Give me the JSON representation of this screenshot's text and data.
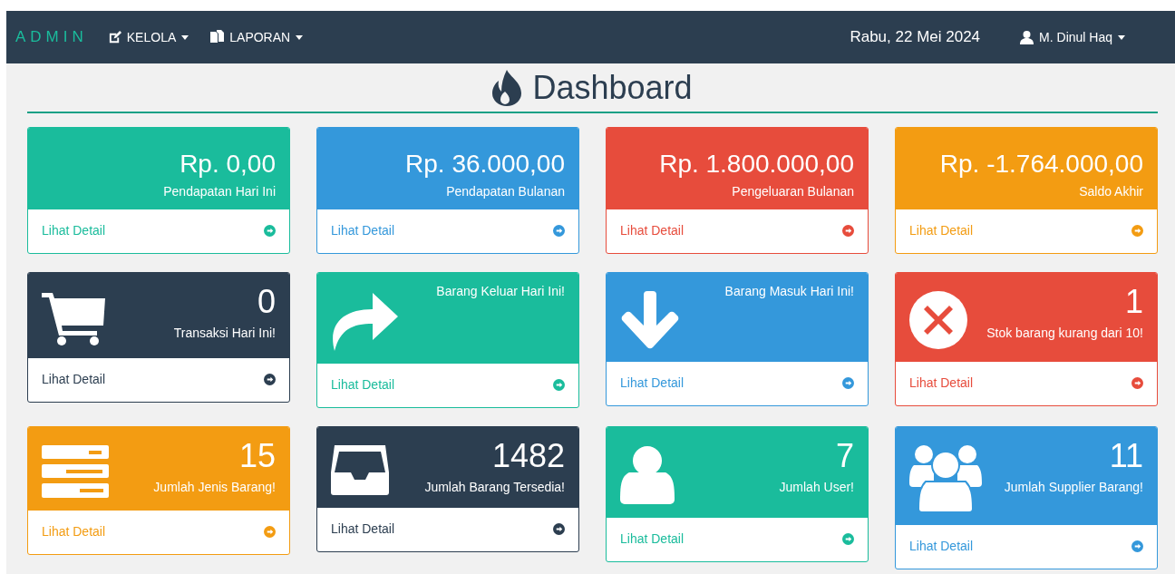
{
  "navbar": {
    "brand": "ADMIN",
    "menus": [
      {
        "label": "KELOLA"
      },
      {
        "label": "LAPORAN"
      }
    ],
    "date": "Rabu, 22 Mei 2024",
    "user": "M. Dinul Haq"
  },
  "heading": "Dashboard",
  "rows": [
    [
      {
        "color": "#1abc9c",
        "value": "Rp. 0,00",
        "label": "Pendapatan Hari Ini",
        "link": "Lihat Detail"
      },
      {
        "color": "#3498db",
        "value": "Rp. 36.000,00",
        "label": "Pendapatan Bulanan",
        "link": "Lihat Detail"
      },
      {
        "color": "#e74c3c",
        "value": "Rp. 1.800.000,00",
        "label": "Pengeluaran Bulanan",
        "link": "Lihat Detail"
      },
      {
        "color": "#f39c12",
        "value": "Rp. -1.764.000,00",
        "label": "Saldo Akhir",
        "link": "Lihat Detail"
      }
    ],
    [
      {
        "color": "#2c3e50",
        "value": "0",
        "label": "Transaksi Hari Ini!",
        "link": "Lihat Detail"
      },
      {
        "color": "#1abc9c",
        "label": "Barang Keluar Hari Ini!",
        "link": "Lihat Detail"
      },
      {
        "color": "#3498db",
        "label": "Barang Masuk Hari Ini!",
        "link": "Lihat Detail"
      },
      {
        "color": "#e74c3c",
        "value": "1",
        "label": "Stok barang kurang dari 10!",
        "link": "Lihat Detail"
      }
    ],
    [
      {
        "color": "#f39c12",
        "value": "15",
        "label": "Jumlah Jenis Barang!",
        "link": "Lihat Detail"
      },
      {
        "color": "#2c3e50",
        "value": "1482",
        "label": "Jumlah Barang Tersedia!",
        "link": "Lihat Detail"
      },
      {
        "color": "#1abc9c",
        "value": "7",
        "label": "Jumlah User!",
        "link": "Lihat Detail"
      },
      {
        "color": "#3498db",
        "value": "11",
        "label": "Jumlah Supplier Barang!",
        "link": "Lihat Detail"
      }
    ]
  ]
}
